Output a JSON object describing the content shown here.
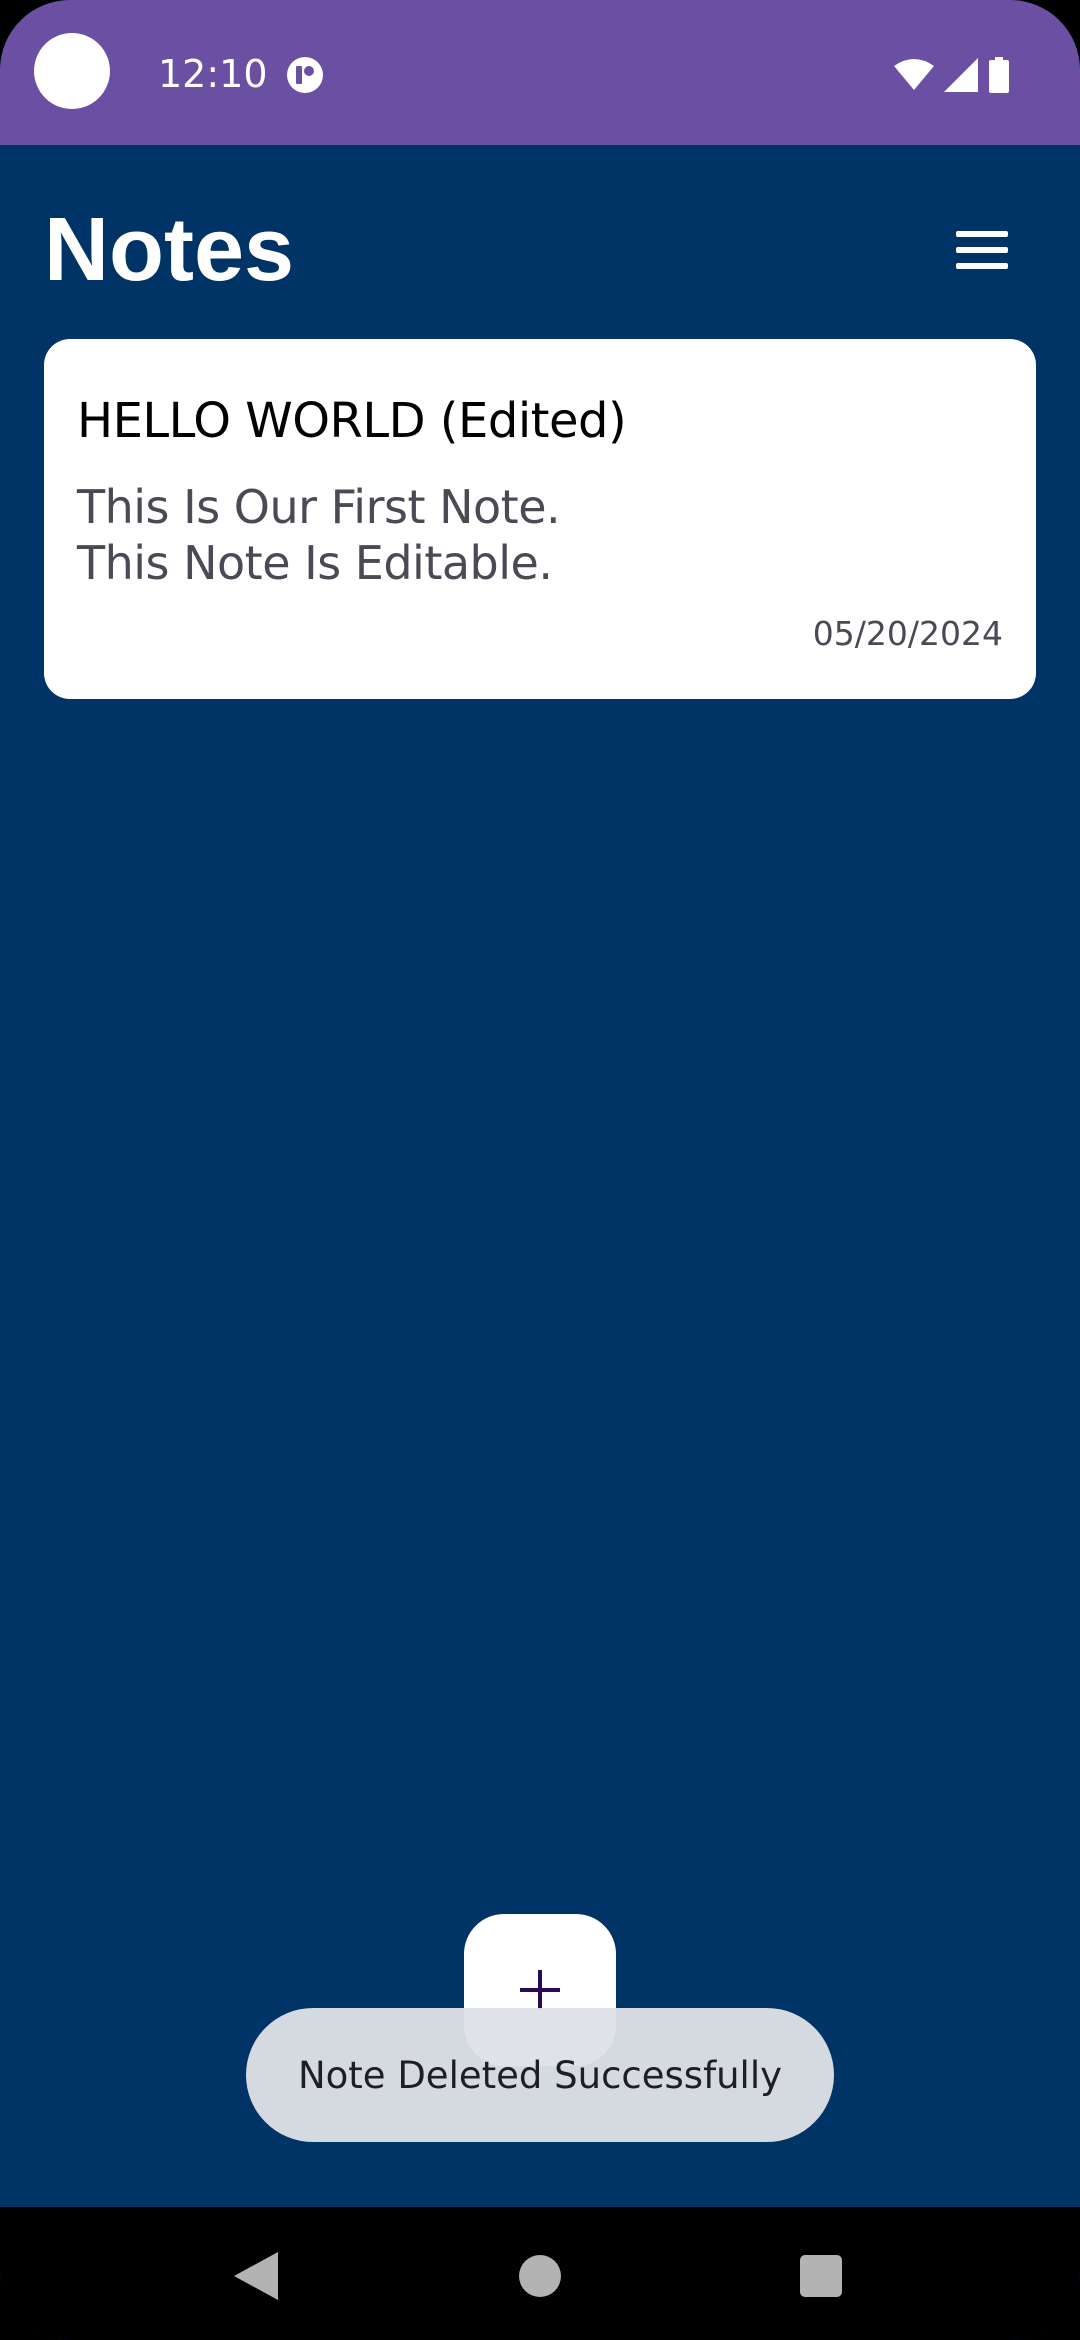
{
  "status_bar": {
    "time": "12:10",
    "background_color": "#6a4fa3",
    "icons": [
      "camera-dot",
      "app-notification-icon",
      "wifi-icon",
      "signal-icon",
      "battery-icon"
    ]
  },
  "header": {
    "title": "Notes",
    "menu_icon": "hamburger-menu-icon"
  },
  "notes": [
    {
      "title": "HELLO WORLD (Edited)",
      "body_lines": [
        "This Is Our First Note.",
        "This Note Is Editable."
      ],
      "date": "05/20/2024"
    }
  ],
  "fab": {
    "icon": "plus-icon",
    "icon_color": "#2a0a55"
  },
  "toast": {
    "message": "Note Deleted Successfully"
  },
  "nav_bar": {
    "icons": [
      "back-icon",
      "home-icon",
      "recents-icon"
    ]
  },
  "colors": {
    "background": "#003366",
    "card": "#ffffff",
    "toast": "#dee1e6"
  }
}
